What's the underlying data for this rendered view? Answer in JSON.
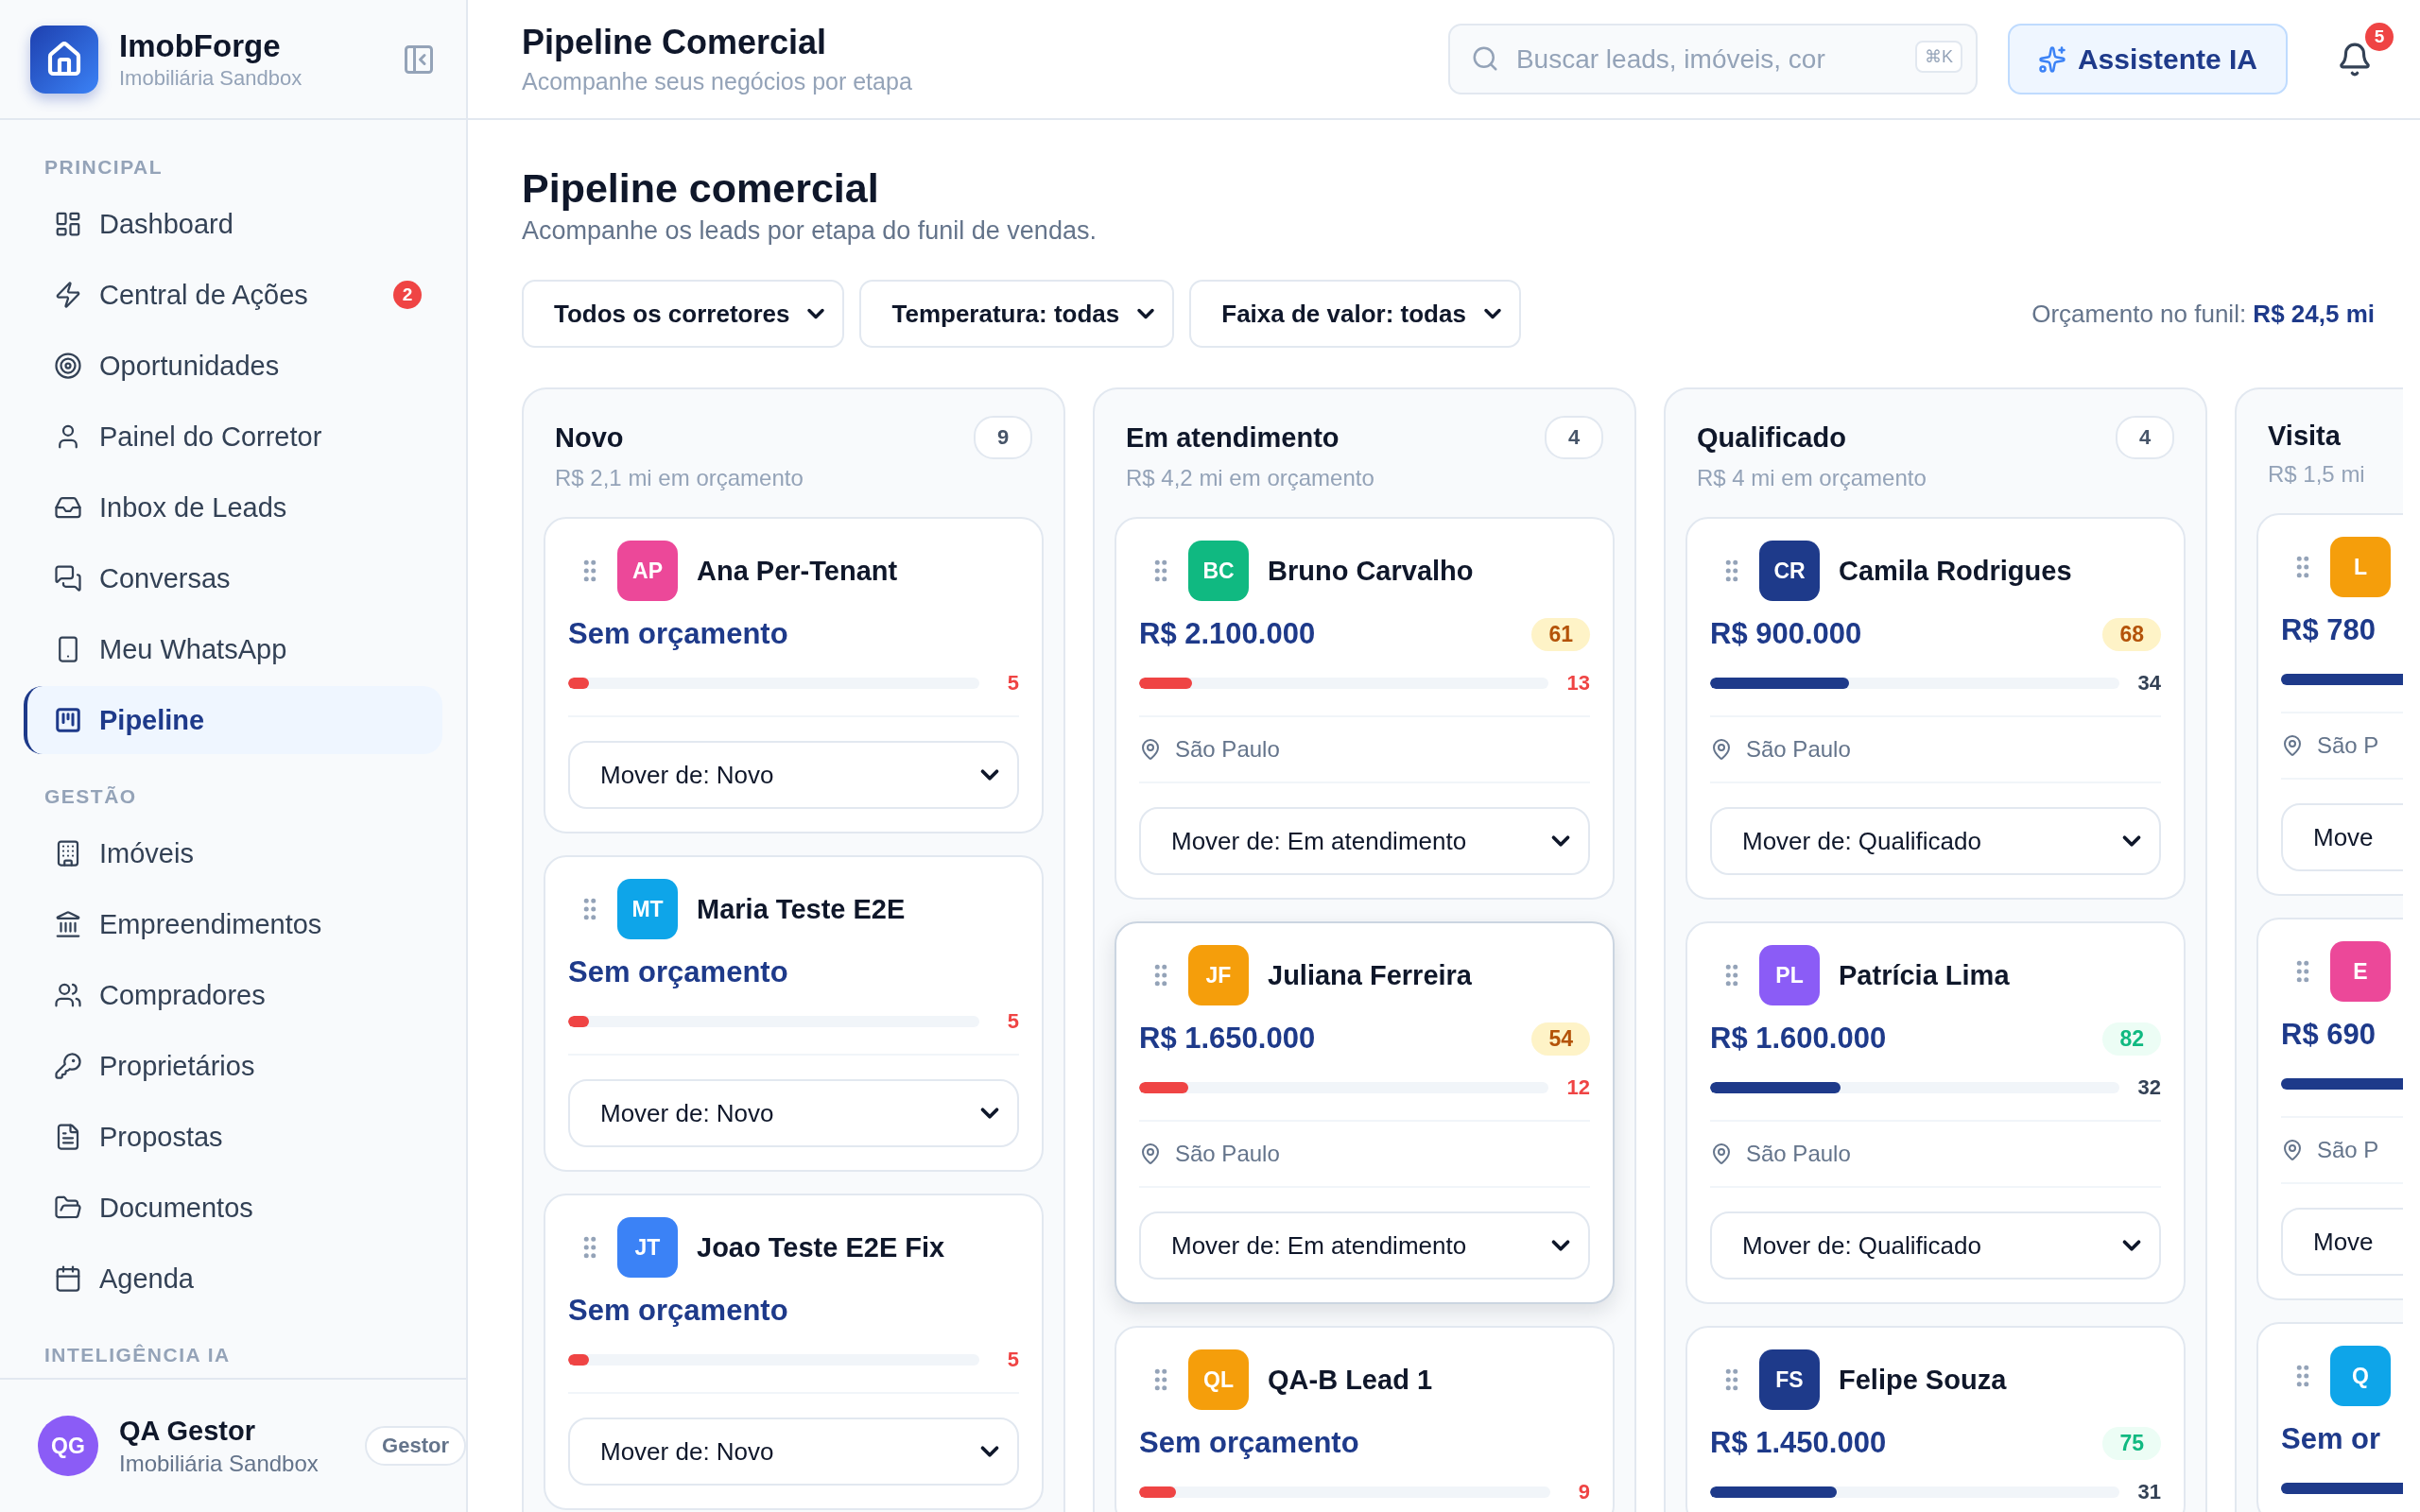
{
  "sidebar": {
    "brand": {
      "name": "ImobForge",
      "subtitle": "Imobiliária Sandbox"
    },
    "sections": [
      {
        "title": "PRINCIPAL",
        "items": [
          {
            "label": "Dashboard",
            "selected": false
          },
          {
            "label": "Central de Ações",
            "selected": false,
            "badge": "2"
          },
          {
            "label": "Oportunidades",
            "selected": false
          },
          {
            "label": "Painel do Corretor",
            "selected": false
          },
          {
            "label": "Inbox de Leads",
            "selected": false
          },
          {
            "label": "Conversas",
            "selected": false
          },
          {
            "label": "Meu WhatsApp",
            "selected": false
          },
          {
            "label": "Pipeline",
            "selected": true
          }
        ]
      },
      {
        "title": "GESTÃO",
        "items": [
          {
            "label": "Imóveis",
            "selected": false
          },
          {
            "label": "Empreendimentos",
            "selected": false
          },
          {
            "label": "Compradores",
            "selected": false
          },
          {
            "label": "Proprietários",
            "selected": false
          },
          {
            "label": "Propostas",
            "selected": false
          },
          {
            "label": "Documentos",
            "selected": false
          },
          {
            "label": "Agenda",
            "selected": false
          }
        ]
      },
      {
        "title": "INTELIGÊNCIA IA"
      }
    ],
    "user": {
      "initials": "QG",
      "name": "QA Gestor",
      "org": "Imobiliária Sandbox",
      "role": "Gestor"
    }
  },
  "header": {
    "title": "Pipeline Comercial",
    "subtitle": "Acompanhe seus negócios por etapa",
    "search": {
      "placeholder": "Buscar leads, imóveis, cor",
      "shortcut": "⌘K"
    },
    "assistant_button": "Assistente IA",
    "notifications": "5"
  },
  "page": {
    "title": "Pipeline comercial",
    "subtitle": "Acompanhe os leads por etapa do funil de vendas.",
    "filters": [
      "Todos os corretores",
      "Temperatura: todas",
      "Faixa de valor: todas"
    ],
    "budget": "Orçamento no funil: **R$ 24,5 mi**"
  },
  "columns": [
    {
      "title": "Novo",
      "count": "9",
      "budget": "R$ 2,1 mi em orçamento",
      "cards": [
        {
          "initials": "AP",
          "color": "#ec4899",
          "name": "Ana Per-Tenant",
          "value": "Sem orçamento",
          "level": 0.05,
          "reading": "5",
          "move": "Mover de: Novo",
          "highlighted": false
        },
        {
          "initials": "MT",
          "color": "#0ea5e9",
          "name": "Maria Teste E2E",
          "value": "Sem orçamento",
          "level": 0.05,
          "reading": "5",
          "move": "Mover de: Novo",
          "highlighted": false
        },
        {
          "initials": "JT",
          "color": "#3b82f6",
          "name": "Joao Teste E2E Fix",
          "value": "Sem orçamento",
          "level": 0.05,
          "reading": "5",
          "move": "Mover de: Novo",
          "highlighted": false
        }
      ]
    },
    {
      "title": "Em atendimento",
      "count": "4",
      "budget": "R$ 4,2 mi em orçamento",
      "cards": [
        {
          "initials": "BC",
          "color": "#10b981",
          "name": "Bruno Carvalho",
          "value": "R$ 2.100.000",
          "score": {
            "text": "61",
            "kind": "medium"
          },
          "level": 0.13,
          "reading": "13",
          "location": "São Paulo",
          "move": "Mover de: Em atendimento",
          "highlighted": false
        },
        {
          "initials": "JF",
          "color": "#f59e0b",
          "name": "Juliana Ferreira",
          "value": "R$ 1.650.000",
          "score": {
            "text": "54",
            "kind": "medium"
          },
          "level": 0.12,
          "reading": "12",
          "location": "São Paulo",
          "move": "Mover de: Em atendimento",
          "highlighted": true
        },
        {
          "initials": "QL",
          "color": "#f59e0b",
          "name": "QA-B Lead 1",
          "value": "Sem orçamento",
          "level": 0.09,
          "reading": "9",
          "highlighted": false
        }
      ]
    },
    {
      "title": "Qualificado",
      "count": "4",
      "budget": "R$ 4 mi em orçamento",
      "cards": [
        {
          "initials": "CR",
          "color": "#1e3a8a",
          "name": "Camila Rodrigues",
          "value": "R$ 900.000",
          "score": {
            "text": "68",
            "kind": "medium"
          },
          "level": 0.34,
          "reading": "34",
          "location": "São Paulo",
          "move": "Mover de: Qualificado",
          "highlighted": false
        },
        {
          "initials": "PL",
          "color": "#8b5cf6",
          "name": "Patrícia Lima",
          "value": "R$ 1.600.000",
          "score": {
            "text": "82",
            "kind": "high"
          },
          "level": 0.32,
          "reading": "32",
          "location": "São Paulo",
          "move": "Mover de: Qualificado",
          "highlighted": false
        },
        {
          "initials": "FS",
          "color": "#1e3a8a",
          "name": "Felipe Souza",
          "value": "R$ 1.450.000",
          "score": {
            "text": "75",
            "kind": "high"
          },
          "level": 0.31,
          "reading": "31",
          "highlighted": false
        }
      ]
    },
    {
      "title": "Visita",
      "budget": "R$ 1,5 mi",
      "cards": [
        {
          "initials": "L",
          "color": "#f59e0b",
          "value": "R$ 780",
          "location": "São P",
          "move": "Move",
          "highlighted": false
        },
        {
          "initials": "E",
          "color": "#ec4899",
          "value": "R$ 690",
          "location": "São P",
          "move": "Move",
          "highlighted": false
        },
        {
          "initials": "Q",
          "color": "#0ea5e9",
          "value": "Sem or",
          "highlighted": false
        }
      ]
    }
  ]
}
